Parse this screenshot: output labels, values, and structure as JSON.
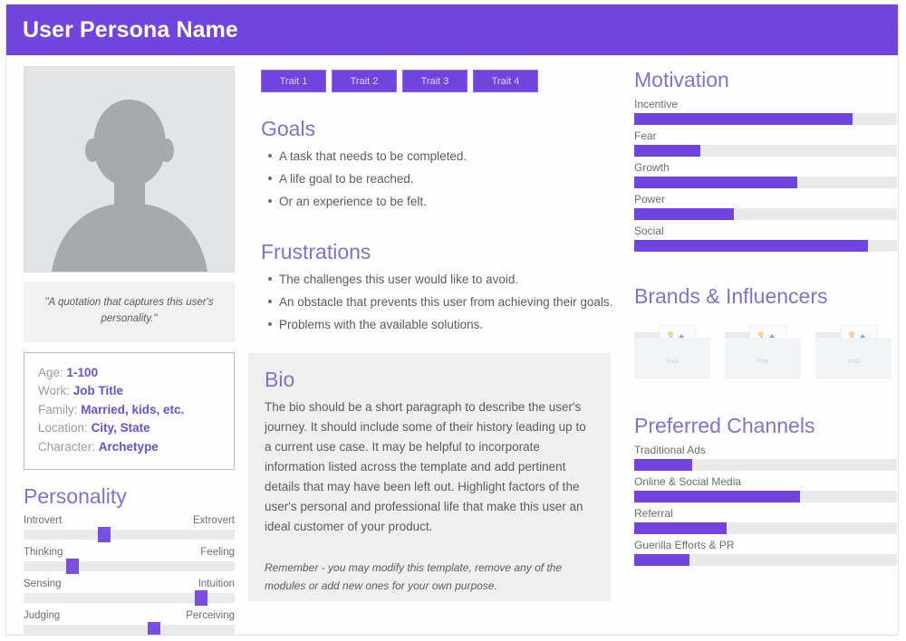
{
  "header": {
    "title": "User Persona Name"
  },
  "colors": {
    "brand_purple": "#7244df",
    "heading_purple": "#8173c9",
    "value_purple": "#6a4fd0",
    "track_gray": "#e9e9e9",
    "panel_gray": "#efefef"
  },
  "avatar": {
    "alt": "user-photo-placeholder"
  },
  "quote": {
    "text": "\"A quotation that captures this user's personality.\""
  },
  "demographics": {
    "rows": [
      {
        "label": "Age:",
        "value": "1-100"
      },
      {
        "label": "Work:",
        "value": "Job Title"
      },
      {
        "label": "Family:",
        "value": "Married, kids, etc."
      },
      {
        "label": "Location:",
        "value": "City, State"
      },
      {
        "label": "Character:",
        "value": "Archetype"
      }
    ]
  },
  "personality": {
    "title": "Personality",
    "sliders": [
      {
        "left": "Introvert",
        "right": "Extrovert",
        "value": 38
      },
      {
        "left": "Thinking",
        "right": "Feeling",
        "value": 23
      },
      {
        "left": "Sensing",
        "right": "Intuition",
        "value": 84
      },
      {
        "left": "Judging",
        "right": "Perceiving",
        "value": 62
      }
    ]
  },
  "traits": [
    {
      "label": "Trait 1"
    },
    {
      "label": "Trait 2"
    },
    {
      "label": "Trait 3"
    },
    {
      "label": "Trait 4"
    }
  ],
  "goals": {
    "title": "Goals",
    "items": [
      "A task that needs to be completed.",
      "A life goal to be reached.",
      "Or an experience to be felt."
    ]
  },
  "frustrations": {
    "title": "Frustrations",
    "items": [
      "The challenges this user would like to avoid.",
      "An obstacle that prevents this user from achieving their goals.",
      "Problems with the available solutions."
    ]
  },
  "bio": {
    "title": "Bio",
    "text": "The bio should be a short paragraph to describe the user's journey. It should include some of their history leading up to a current use case. It may be helpful to incorporate information listed across the template and add pertinent details that may have been left out. Highlight factors of the user's personal and professional life that make this user an ideal customer of your product.",
    "note": "Remember - you may modify this template, remove any of the modules or add new ones for your own purpose."
  },
  "motivation": {
    "title": "Motivation",
    "items": [
      {
        "label": "Incentive",
        "value": 83
      },
      {
        "label": "Fear",
        "value": 25
      },
      {
        "label": "Growth",
        "value": 62
      },
      {
        "label": "Power",
        "value": 38
      },
      {
        "label": "Social",
        "value": 89
      }
    ]
  },
  "brands": {
    "title": "Brands & Influencers",
    "thumbs": [
      {
        "caption": "image-placeholder"
      },
      {
        "caption": "image-placeholder"
      },
      {
        "caption": "image-placeholder"
      }
    ]
  },
  "channels": {
    "title": "Preferred Channels",
    "items": [
      {
        "label": "Traditional Ads",
        "value": 22
      },
      {
        "label": "Online & Social Media",
        "value": 63
      },
      {
        "label": "Referral",
        "value": 35
      },
      {
        "label": "Guerilla Efforts & PR",
        "value": 21
      }
    ]
  },
  "chart_data": [
    {
      "type": "bar",
      "title": "Motivation",
      "orientation": "horizontal",
      "categories": [
        "Incentive",
        "Fear",
        "Growth",
        "Power",
        "Social"
      ],
      "values": [
        83,
        25,
        62,
        38,
        89
      ],
      "xlabel": "",
      "ylabel": "",
      "xlim": [
        0,
        100
      ],
      "grid": false,
      "legend": false
    },
    {
      "type": "bar",
      "title": "Preferred Channels",
      "orientation": "horizontal",
      "categories": [
        "Traditional Ads",
        "Online & Social Media",
        "Referral",
        "Guerilla Efforts & PR"
      ],
      "values": [
        22,
        63,
        35,
        21
      ],
      "xlabel": "",
      "ylabel": "",
      "xlim": [
        0,
        100
      ],
      "grid": false,
      "legend": false
    },
    {
      "type": "bar",
      "title": "Personality",
      "orientation": "horizontal",
      "categories": [
        "Introvert-Extrovert",
        "Thinking-Feeling",
        "Sensing-Intuition",
        "Judging-Perceiving"
      ],
      "values": [
        38,
        23,
        84,
        62
      ],
      "xlabel": "",
      "ylabel": "",
      "xlim": [
        0,
        100
      ],
      "grid": false,
      "legend": false
    }
  ]
}
